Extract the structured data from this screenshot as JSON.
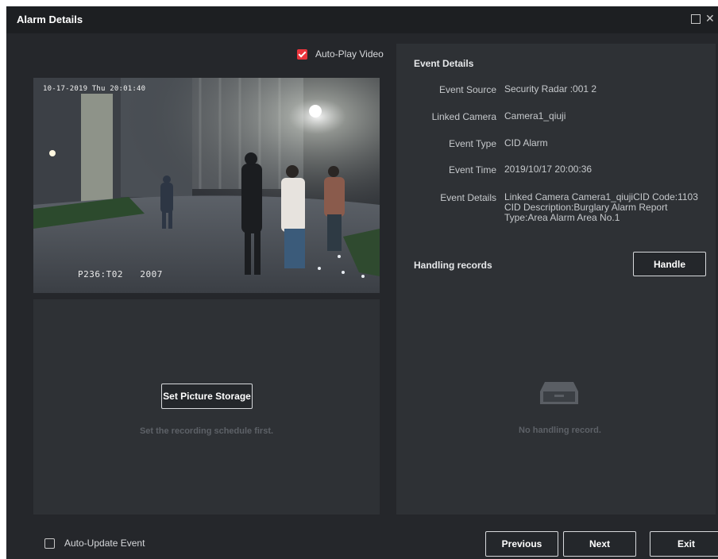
{
  "window": {
    "title": "Alarm Details"
  },
  "video": {
    "autoplay_label": "Auto-Play Video",
    "autoplay_checked": true,
    "timestamp": "10-17-2019 Thu 20:01:40",
    "overlay_code": "P236:T02   2007"
  },
  "picture": {
    "button_label": "Set Picture Storage",
    "hint": "Set the recording schedule first."
  },
  "details": {
    "title": "Event Details",
    "fields": [
      {
        "label": "Event Source",
        "value": "Security Radar :001 2"
      },
      {
        "label": "Linked Camera",
        "value": "Camera1_qiuji"
      },
      {
        "label": "Event Type",
        "value": "CID Alarm"
      },
      {
        "label": "Event Time",
        "value": "2019/10/17 20:00:36"
      },
      {
        "label": "Event Details",
        "value": "Linked Camera Camera1_qiujiCID Code:1103 CID Description:Burglary Alarm Report Type:Area Alarm Area No.1"
      }
    ],
    "handling_title": "Handling records",
    "handle_button": "Handle",
    "empty_text": "No handling record."
  },
  "footer": {
    "auto_update_label": "Auto-Update Event",
    "auto_update_checked": false,
    "previous_button": "Previous",
    "next_button": "Next",
    "exit_button": "Exit"
  },
  "colors": {
    "accent": "#e8343c",
    "background": "#25272b",
    "panel": "#2e3135"
  }
}
